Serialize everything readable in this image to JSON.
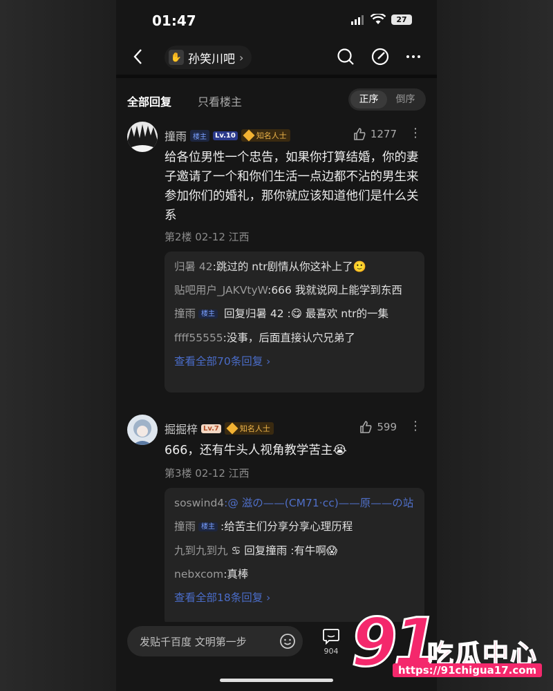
{
  "status": {
    "time": "01:47",
    "battery": "27"
  },
  "nav": {
    "forum_name": "孙笑川吧",
    "chevron": "›"
  },
  "tabs": {
    "all": "全部回复",
    "op_only": "只看楼主",
    "order_asc": "正序",
    "order_desc": "倒序"
  },
  "posts": [
    {
      "user": "撞雨",
      "op_badge": "楼主",
      "level": "Lv.10",
      "known_badge": "知名人士",
      "likes": "1277",
      "content": "给各位男性一个忠告，如果你打算结婚，你的妻子邀请了一个和你们生活一点边都不沾的男生来参加你们的婚礼，那你就应该知道他们是什么关系",
      "meta": "第2楼 02-12 江西",
      "replies": [
        {
          "who": "归暑 42",
          "text": ":跳过的 ntr剧情从你这补上了🙂"
        },
        {
          "who": "贴吧用户_JAKVtyW",
          "text": ":666 我就说网上能学到东西"
        },
        {
          "who": "撞雨",
          "tag": "楼主",
          "text": " 回复归暑 42 :😋 最喜欢 ntr的一集"
        },
        {
          "who": "ffff55555",
          "text": ":没事，后面直接认穴兄弟了"
        }
      ],
      "view_all": "查看全部70条回复 ›"
    },
    {
      "user": "掘掘梓",
      "level": "Lv.7",
      "known_badge": "知名人士",
      "likes": "599",
      "content": "666，还有牛头人视角教学苦主😭",
      "meta": "第3楼 02-12 江西",
      "replies": [
        {
          "who": "soswind4",
          "link": ":@ 滋の——(CM71·cc)——原——の站"
        },
        {
          "who": "撞雨",
          "tag": "楼主",
          "text": ":给苦主们分享分享心理历程"
        },
        {
          "who": "九到九到九",
          "text": " ♋ 回复撞雨 :有牛啊😱"
        },
        {
          "who": "nebxcom",
          "text": ":真棒"
        }
      ],
      "view_all": "查看全部18条回复 ›"
    }
  ],
  "bottom": {
    "input_placeholder": "发贴千百度 文明第一步",
    "comment_count": "904"
  },
  "watermark": {
    "number": "91",
    "title": "吃瓜中心",
    "url": "https://91chigua17.com"
  },
  "colors": {
    "accent": "#4a6cc8",
    "brand": "#f4286c"
  }
}
